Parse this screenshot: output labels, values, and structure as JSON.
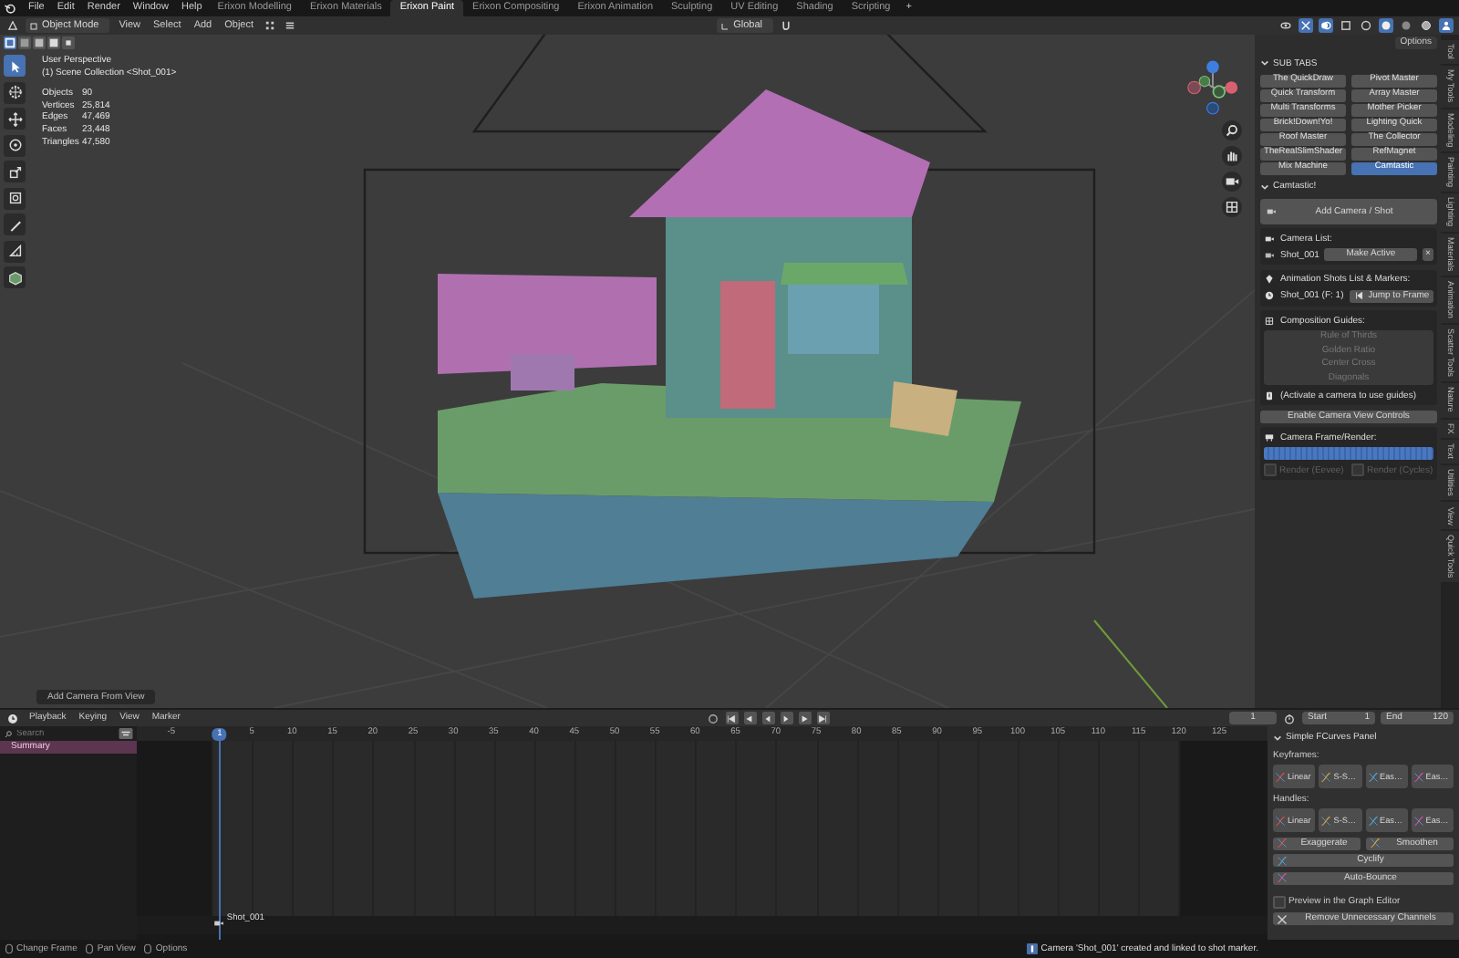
{
  "menu_bar": {
    "menus": [
      "File",
      "Edit",
      "Render",
      "Window",
      "Help"
    ],
    "workspaces": [
      {
        "label": "Erixon Modelling",
        "selected": false
      },
      {
        "label": "Erixon Materials",
        "selected": false
      },
      {
        "label": "Erixon Paint",
        "selected": true
      },
      {
        "label": "Erixon Compositing",
        "selected": false
      },
      {
        "label": "Erixon Animation",
        "selected": false
      },
      {
        "label": "Sculpting",
        "selected": false
      },
      {
        "label": "UV Editing",
        "selected": false
      },
      {
        "label": "Shading",
        "selected": false
      },
      {
        "label": "Scripting",
        "selected": false
      }
    ],
    "add_workspace": "+"
  },
  "header": {
    "mode": "Object Mode",
    "menus": [
      "View",
      "Select",
      "Add",
      "Object"
    ],
    "orientation": "Global"
  },
  "toolbar": {
    "tools": [
      {
        "kind": "select",
        "selected": true
      },
      {
        "kind": "cursor",
        "selected": false
      },
      {
        "kind": "move",
        "selected": false
      },
      {
        "kind": "rotate",
        "selected": false
      },
      {
        "kind": "scale",
        "selected": false
      },
      {
        "kind": "transform",
        "selected": false
      },
      {
        "kind": "annotate",
        "selected": false
      },
      {
        "kind": "measure",
        "selected": false
      },
      {
        "kind": "add-cube",
        "selected": false
      }
    ]
  },
  "viewport": {
    "view_name": "User Perspective",
    "collection": "(1) Scene Collection <Shot_001>",
    "stats": [
      {
        "label": "Objects",
        "value": "90"
      },
      {
        "label": "Vertices",
        "value": "25,814"
      },
      {
        "label": "Edges",
        "value": "47,469"
      },
      {
        "label": "Faces",
        "value": "23,448"
      },
      {
        "label": "Triangles",
        "value": "47,580"
      }
    ],
    "last_operator": "Add Camera From View"
  },
  "sidebar": {
    "options": "Options",
    "tabs": [
      "Tool",
      "My Tools",
      "Modeling",
      "Painting",
      "Lighting",
      "Materials",
      "Animation",
      "Scatter Tools",
      "Nature",
      "FX",
      "Text",
      "Utilities",
      "View",
      "Quick Tools"
    ],
    "sub_tabs_title": "SUB TABS",
    "sub_tabs": [
      {
        "label": "The QuickDraw",
        "selected": false
      },
      {
        "label": "Pivot Master",
        "selected": false
      },
      {
        "label": "Quick Transform",
        "selected": false
      },
      {
        "label": "Array Master",
        "selected": false
      },
      {
        "label": "Multi Transforms",
        "selected": false
      },
      {
        "label": "Mother Picker",
        "selected": false
      },
      {
        "label": "Brick!Down!Yo!",
        "selected": false
      },
      {
        "label": "Lighting Quick",
        "selected": false
      },
      {
        "label": "Roof Master",
        "selected": false
      },
      {
        "label": "The Collector",
        "selected": false
      },
      {
        "label": "TheRealSlimShader",
        "selected": false
      },
      {
        "label": "RefMagnet",
        "selected": false
      },
      {
        "label": "Mix Machine",
        "selected": false
      },
      {
        "label": "Camtastic",
        "selected": true
      }
    ],
    "camtastic": {
      "title": "Camtastic!",
      "add_button": "Add Camera / Shot",
      "camera_list_label": "Camera List:",
      "camera": "Shot_001",
      "make_active": "Make Active",
      "remove": "×",
      "shots_label": "Animation Shots List & Markers:",
      "shot": "Shot_001 (F: 1)",
      "jump_button": "Jump to Frame",
      "guides_label": "Composition Guides:",
      "guides": [
        {
          "label": "Rule of Thirds",
          "disabled": true
        },
        {
          "label": "Golden Ratio",
          "disabled": true
        },
        {
          "label": "Center Cross",
          "disabled": true
        },
        {
          "label": "Diagonals",
          "disabled": true
        }
      ],
      "guides_hint": "(Activate a camera to use guides)",
      "view_controls_button": "Enable Camera View Controls",
      "render_label": "Camera Frame/Render:",
      "render_options": [
        {
          "label": "Render (Eevee)",
          "checked": false,
          "disabled": true
        },
        {
          "label": "Render (Cycles)",
          "checked": false,
          "disabled": true
        }
      ]
    }
  },
  "timeline": {
    "menus": [
      "Playback",
      "Keying",
      "View",
      "Marker"
    ],
    "current_frame": "1",
    "start_label": "Start",
    "start": "1",
    "end_label": "End",
    "end": "120",
    "search_placeholder": "Search",
    "channels": [
      {
        "label": "Summary",
        "selected": true
      }
    ],
    "playhead": "1",
    "ticks": [
      "-5",
      "5",
      "10",
      "15",
      "20",
      "25",
      "30",
      "35",
      "40",
      "45",
      "50",
      "55",
      "60",
      "65",
      "70",
      "75",
      "80",
      "85",
      "90",
      "95",
      "100",
      "105",
      "110",
      "115",
      "120",
      "125"
    ],
    "marker": "Shot_001"
  },
  "fcurves_panel": {
    "title": "Simple FCurves Panel",
    "keyframes_label": "Keyframes:",
    "keyframe_buttons": [
      "Linear",
      "S-S…",
      "Eas…",
      "Eas…"
    ],
    "handles_label": "Handles:",
    "handle_buttons": [
      "Linear",
      "S-S…",
      "Eas…",
      "Eas…"
    ],
    "pair_buttons": [
      "Exaggerate",
      "Smoothen"
    ],
    "wide_buttons": [
      "Cyclify",
      "Auto-Bounce"
    ],
    "preview": {
      "label": "Preview in the Graph Editor",
      "checked": false
    },
    "remove_button": "Remove Unnecessary Channels"
  },
  "status_bar": {
    "hints": [
      "Change Frame",
      "Pan View",
      "Options"
    ],
    "message": "Camera 'Shot_001' created and linked to shot marker."
  }
}
